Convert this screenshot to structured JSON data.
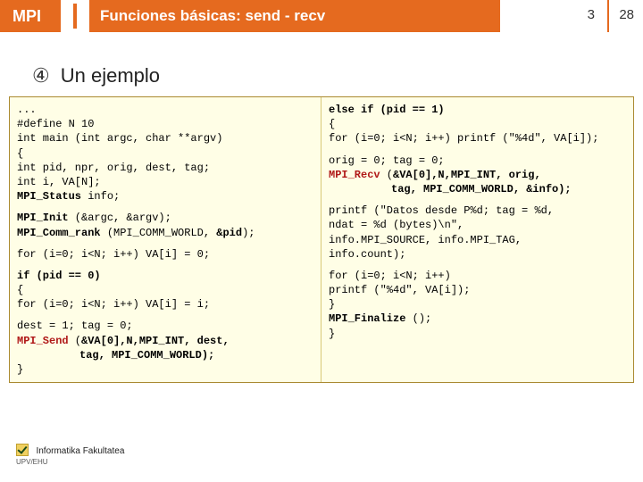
{
  "header": {
    "brand": "MPI",
    "title": "Funciones básicas: send - recv",
    "page_current": "3",
    "page_total": "28"
  },
  "subtitle": {
    "marker": "④",
    "text": "Un ejemplo"
  },
  "code": {
    "left": {
      "l1": "...",
      "l2": "#define N 10",
      "l3": "int main (int argc, char **argv)",
      "l4": "{",
      "l5": " int pid, npr, orig, dest, tag;",
      "l6": " int i, VA[N];",
      "l7a": " ",
      "l7b": "MPI_Status",
      "l7c": " info;",
      "l8a": " ",
      "l8b": "MPI_Init",
      "l8c": " (&argc, &argv);",
      "l9a": " ",
      "l9b": "MPI_Comm_rank",
      "l9c": " (MPI_COMM_WORLD, ",
      "l9d": "&pid",
      "l9e": ");",
      "l10": " for (i=0; i<N; i++) VA[i] = 0;",
      "l11a": " ",
      "l11b": "if (pid == 0)",
      "l12": " {",
      "l13": "   for (i=0; i<N; i++) VA[i] = i;",
      "l14": "   dest = 1; tag = 0;",
      "l15a": "   ",
      "l15b": "MPI_Send",
      "l15c": " (",
      "l15d": "&VA[0],N,MPI_INT, dest,",
      "l16": "tag, MPI_COMM_WORLD);",
      "l17": " }"
    },
    "right": {
      "r1a": " ",
      "r1b": "else if (pid == 1)",
      "r2": " {",
      "r3": "   for (i=0; i<N; i++) printf (\"%4d\", VA[i]);",
      "r4": "   orig = 0; tag = 0;",
      "r5a": "   ",
      "r5b": "MPI_Recv",
      "r5c": " (",
      "r5d": "&VA[0],N,MPI_INT, orig,",
      "r6": "tag, MPI_COMM_WORLD, &info);",
      "r7": "   printf (\"Datos desde P%d; tag = %d,",
      "r8": "            ndat = %d (bytes)\\n\",",
      "r9": "            info.MPI_SOURCE, info.MPI_TAG,",
      "r10": "            info.count);",
      "r11": "   for (i=0; i<N; i++)",
      "r12": "         printf (\"%4d\", VA[i]);",
      "r13": " }",
      "r14a": " ",
      "r14b": "MPI_Finalize",
      "r14c": " ();",
      "r15": "}"
    }
  },
  "footer": {
    "faculty": "Informatika Fakultatea",
    "university": "UPV/EHU"
  }
}
